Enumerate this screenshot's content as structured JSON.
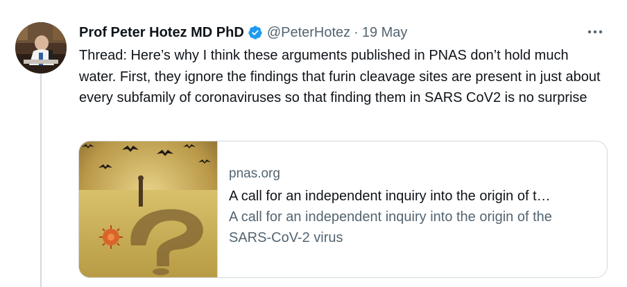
{
  "tweet": {
    "author_name": "Prof Peter Hotez MD PhD",
    "handle": "@PeterHotez",
    "separator": "·",
    "date": "19 May",
    "text": "Thread: Here’s why I think these arguments published in PNAS don’t hold much water. First, they ignore the findings that furin cleavage sites are present in just about every subfamily of coronaviruses so that finding them in SARS CoV2 is no surprise",
    "verified_color": "#1d9bf0",
    "more_icon": "more-horizontal-icon"
  },
  "card": {
    "domain": "pnas.org",
    "title": "A call for an independent inquiry into the origin of t…",
    "description": "A call for an independent inquiry into the origin of the SARS-CoV-2 virus"
  }
}
